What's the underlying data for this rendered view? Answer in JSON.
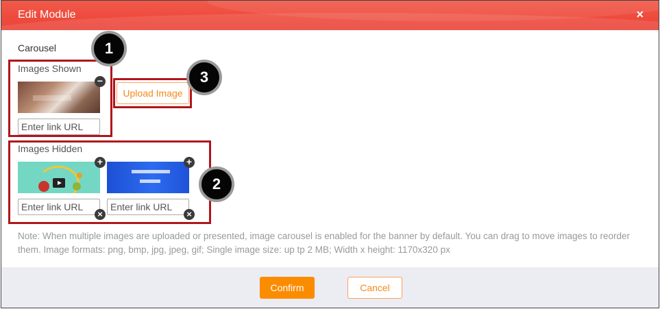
{
  "dialog": {
    "title": "Edit Module",
    "close_icon": "×"
  },
  "carousel": {
    "section_label": "Carousel",
    "shown": {
      "label": "Images Shown",
      "remove_icon": "−",
      "url_placeholder": "Enter link URL"
    },
    "upload_label": "Upload Image",
    "hidden": {
      "label": "Images Hidden",
      "add_icon": "+",
      "delete_icon": "×",
      "url_placeholder": "Enter link URL"
    },
    "note": "Note: When multiple images are uploaded or presented, image carousel is enabled for the banner by default. You can drag to move images to reorder them. Image formats: png, bmp, jpg, jpeg, gif; Single image size: up tp 2 MB; Width x height: 1170x320 px"
  },
  "callouts": [
    "1",
    "2",
    "3"
  ],
  "footer": {
    "confirm_label": "Confirm",
    "cancel_label": "Cancel"
  },
  "colors": {
    "header": "#ee4a3c",
    "accent": "#fb8c00",
    "callout": "#b0151b"
  }
}
